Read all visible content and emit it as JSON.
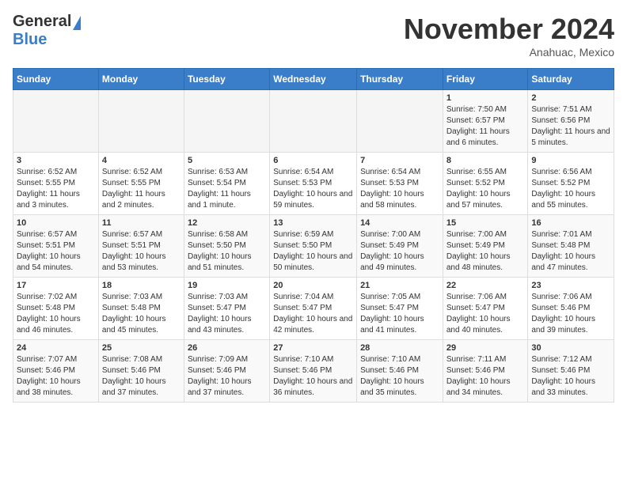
{
  "header": {
    "logo_general": "General",
    "logo_blue": "Blue",
    "month_title": "November 2024",
    "location": "Anahuac, Mexico"
  },
  "calendar": {
    "days_of_week": [
      "Sunday",
      "Monday",
      "Tuesday",
      "Wednesday",
      "Thursday",
      "Friday",
      "Saturday"
    ],
    "weeks": [
      [
        {
          "day": "",
          "info": ""
        },
        {
          "day": "",
          "info": ""
        },
        {
          "day": "",
          "info": ""
        },
        {
          "day": "",
          "info": ""
        },
        {
          "day": "",
          "info": ""
        },
        {
          "day": "1",
          "info": "Sunrise: 7:50 AM\nSunset: 6:57 PM\nDaylight: 11 hours and 6 minutes."
        },
        {
          "day": "2",
          "info": "Sunrise: 7:51 AM\nSunset: 6:56 PM\nDaylight: 11 hours and 5 minutes."
        }
      ],
      [
        {
          "day": "3",
          "info": "Sunrise: 6:52 AM\nSunset: 5:55 PM\nDaylight: 11 hours and 3 minutes."
        },
        {
          "day": "4",
          "info": "Sunrise: 6:52 AM\nSunset: 5:55 PM\nDaylight: 11 hours and 2 minutes."
        },
        {
          "day": "5",
          "info": "Sunrise: 6:53 AM\nSunset: 5:54 PM\nDaylight: 11 hours and 1 minute."
        },
        {
          "day": "6",
          "info": "Sunrise: 6:54 AM\nSunset: 5:53 PM\nDaylight: 10 hours and 59 minutes."
        },
        {
          "day": "7",
          "info": "Sunrise: 6:54 AM\nSunset: 5:53 PM\nDaylight: 10 hours and 58 minutes."
        },
        {
          "day": "8",
          "info": "Sunrise: 6:55 AM\nSunset: 5:52 PM\nDaylight: 10 hours and 57 minutes."
        },
        {
          "day": "9",
          "info": "Sunrise: 6:56 AM\nSunset: 5:52 PM\nDaylight: 10 hours and 55 minutes."
        }
      ],
      [
        {
          "day": "10",
          "info": "Sunrise: 6:57 AM\nSunset: 5:51 PM\nDaylight: 10 hours and 54 minutes."
        },
        {
          "day": "11",
          "info": "Sunrise: 6:57 AM\nSunset: 5:51 PM\nDaylight: 10 hours and 53 minutes."
        },
        {
          "day": "12",
          "info": "Sunrise: 6:58 AM\nSunset: 5:50 PM\nDaylight: 10 hours and 51 minutes."
        },
        {
          "day": "13",
          "info": "Sunrise: 6:59 AM\nSunset: 5:50 PM\nDaylight: 10 hours and 50 minutes."
        },
        {
          "day": "14",
          "info": "Sunrise: 7:00 AM\nSunset: 5:49 PM\nDaylight: 10 hours and 49 minutes."
        },
        {
          "day": "15",
          "info": "Sunrise: 7:00 AM\nSunset: 5:49 PM\nDaylight: 10 hours and 48 minutes."
        },
        {
          "day": "16",
          "info": "Sunrise: 7:01 AM\nSunset: 5:48 PM\nDaylight: 10 hours and 47 minutes."
        }
      ],
      [
        {
          "day": "17",
          "info": "Sunrise: 7:02 AM\nSunset: 5:48 PM\nDaylight: 10 hours and 46 minutes."
        },
        {
          "day": "18",
          "info": "Sunrise: 7:03 AM\nSunset: 5:48 PM\nDaylight: 10 hours and 45 minutes."
        },
        {
          "day": "19",
          "info": "Sunrise: 7:03 AM\nSunset: 5:47 PM\nDaylight: 10 hours and 43 minutes."
        },
        {
          "day": "20",
          "info": "Sunrise: 7:04 AM\nSunset: 5:47 PM\nDaylight: 10 hours and 42 minutes."
        },
        {
          "day": "21",
          "info": "Sunrise: 7:05 AM\nSunset: 5:47 PM\nDaylight: 10 hours and 41 minutes."
        },
        {
          "day": "22",
          "info": "Sunrise: 7:06 AM\nSunset: 5:47 PM\nDaylight: 10 hours and 40 minutes."
        },
        {
          "day": "23",
          "info": "Sunrise: 7:06 AM\nSunset: 5:46 PM\nDaylight: 10 hours and 39 minutes."
        }
      ],
      [
        {
          "day": "24",
          "info": "Sunrise: 7:07 AM\nSunset: 5:46 PM\nDaylight: 10 hours and 38 minutes."
        },
        {
          "day": "25",
          "info": "Sunrise: 7:08 AM\nSunset: 5:46 PM\nDaylight: 10 hours and 37 minutes."
        },
        {
          "day": "26",
          "info": "Sunrise: 7:09 AM\nSunset: 5:46 PM\nDaylight: 10 hours and 37 minutes."
        },
        {
          "day": "27",
          "info": "Sunrise: 7:10 AM\nSunset: 5:46 PM\nDaylight: 10 hours and 36 minutes."
        },
        {
          "day": "28",
          "info": "Sunrise: 7:10 AM\nSunset: 5:46 PM\nDaylight: 10 hours and 35 minutes."
        },
        {
          "day": "29",
          "info": "Sunrise: 7:11 AM\nSunset: 5:46 PM\nDaylight: 10 hours and 34 minutes."
        },
        {
          "day": "30",
          "info": "Sunrise: 7:12 AM\nSunset: 5:46 PM\nDaylight: 10 hours and 33 minutes."
        }
      ]
    ]
  }
}
